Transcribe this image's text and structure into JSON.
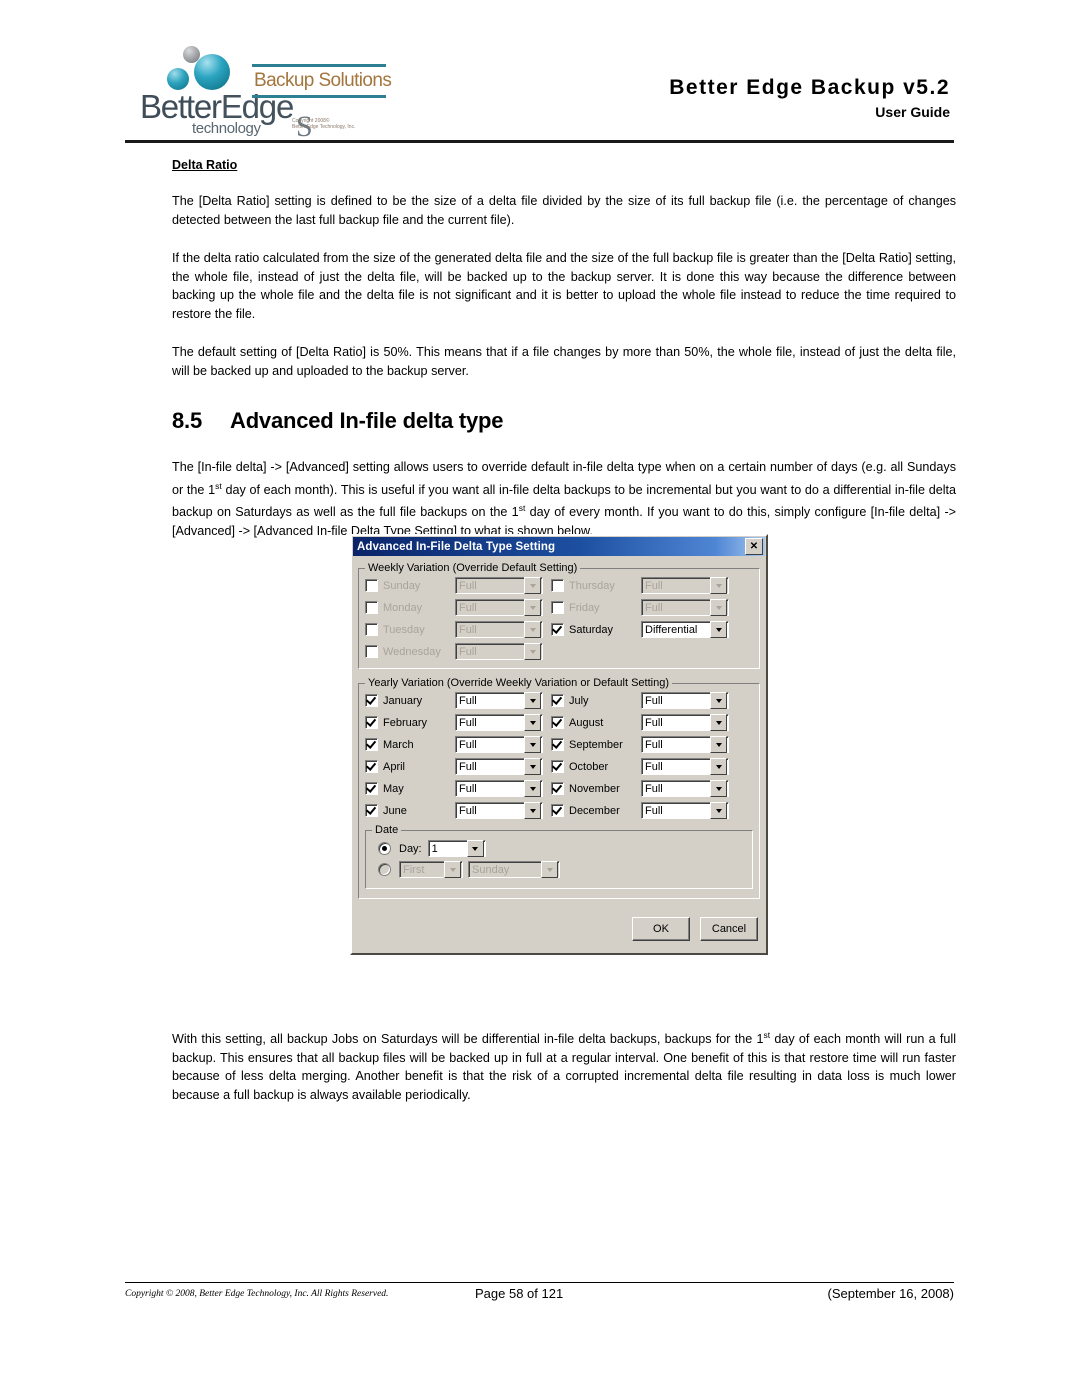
{
  "header": {
    "logo": {
      "wordmark_better": "Better",
      "wordmark_edge": "Edge",
      "subword": "technology",
      "tail": "S",
      "solutions_text": "Backup Solutions",
      "copyright_line1": "Copyright 2008©",
      "copyright_line2": "Better Edge Technology, Inc."
    },
    "title": "Better Edge Backup  v5.2",
    "subtitle": "User Guide"
  },
  "content": {
    "sub_heading": "Delta Ratio",
    "para1": "The [Delta Ratio] setting is defined to be the size of a delta file divided by the size of its full backup file (i.e. the percentage of changes detected between the last full backup file and the current file).",
    "para2": "If the delta ratio calculated from the size of the generated delta file and the size of the full backup file is greater than the [Delta Ratio] setting, the whole file, instead of just the delta file, will be backed up to the backup server. It is done this way because the difference between backing up the whole file and the delta file is not significant and it is better to upload the whole file instead to reduce the time required to restore the file.",
    "para3": "The default setting of [Delta Ratio] is 50%. This means that if a file changes by more than 50%, the whole file, instead of just the delta file, will be backed up and uploaded to the backup server.",
    "section_number": "8.5",
    "section_title": "Advanced In-file delta type",
    "para4_a": "The [In-file delta] -> [Advanced] setting allows users to override default in-file delta type when on a certain number of days (e.g. all Sundays or the 1",
    "para4_sup1": "st",
    "para4_b": " day of each month). This is useful if you want all in-file delta backups to be incremental but you want to do a differential in-file delta backup on Saturdays as well as the full file backups on the 1",
    "para4_sup2": "st",
    "para4_c": " day of every month. If you want to do this, simply configure [In-file delta] -> [Advanced] -> [Advanced In-file Delta Type Setting] to what is shown below.",
    "para5_a": "With this setting, all backup Jobs on Saturdays will be differential in-file delta backups, backups for the 1",
    "para5_sup": "st",
    "para5_b": " day of each month will run a full backup. This ensures that all backup files will be backed up in full at a regular interval. One benefit of this is that restore time will run faster because of less delta merging. Another benefit is that the risk of a corrupted incremental delta file resulting in data loss is much lower because a full backup is always available periodically."
  },
  "dialog": {
    "title": "Advanced In-File Delta Type Setting",
    "close_label": "✕",
    "weekly": {
      "legend": "Weekly Variation (Override Default Setting)",
      "left_rows": [
        {
          "day": "Sunday",
          "checked": false,
          "enabled": false,
          "value": "Full"
        },
        {
          "day": "Monday",
          "checked": false,
          "enabled": false,
          "value": "Full"
        },
        {
          "day": "Tuesday",
          "checked": false,
          "enabled": false,
          "value": "Full"
        },
        {
          "day": "Wednesday",
          "checked": false,
          "enabled": false,
          "value": "Full"
        }
      ],
      "right_rows": [
        {
          "day": "Thursday",
          "checked": false,
          "enabled": false,
          "value": "Full"
        },
        {
          "day": "Friday",
          "checked": false,
          "enabled": false,
          "value": "Full"
        },
        {
          "day": "Saturday",
          "checked": true,
          "enabled": true,
          "value": "Differential"
        }
      ]
    },
    "yearly": {
      "legend": "Yearly Variation (Override Weekly Variation or Default Setting)",
      "left_rows": [
        {
          "month": "January",
          "checked": true,
          "enabled": true,
          "value": "Full"
        },
        {
          "month": "February",
          "checked": true,
          "enabled": true,
          "value": "Full"
        },
        {
          "month": "March",
          "checked": true,
          "enabled": true,
          "value": "Full"
        },
        {
          "month": "April",
          "checked": true,
          "enabled": true,
          "value": "Full"
        },
        {
          "month": "May",
          "checked": true,
          "enabled": true,
          "value": "Full"
        },
        {
          "month": "June",
          "checked": true,
          "enabled": true,
          "value": "Full"
        }
      ],
      "right_rows": [
        {
          "month": "July",
          "checked": true,
          "enabled": true,
          "value": "Full"
        },
        {
          "month": "August",
          "checked": true,
          "enabled": true,
          "value": "Full"
        },
        {
          "month": "September",
          "checked": true,
          "enabled": true,
          "value": "Full"
        },
        {
          "month": "October",
          "checked": true,
          "enabled": true,
          "value": "Full"
        },
        {
          "month": "November",
          "checked": true,
          "enabled": true,
          "value": "Full"
        },
        {
          "month": "December",
          "checked": true,
          "enabled": true,
          "value": "Full"
        }
      ]
    },
    "date": {
      "legend": "Date",
      "day_label": "Day:",
      "day_value": "1",
      "day_selected": true,
      "ordinal_value": "First",
      "weekday_value": "Sunday",
      "ordinal_selected": false
    },
    "ok_label": "OK",
    "cancel_label": "Cancel"
  },
  "footer": {
    "copyright": "Copyright © 2008, Better Edge Technology, Inc.   All Rights Reserved.",
    "page": "Page 58 of 121",
    "date": "(September 16, 2008)"
  }
}
